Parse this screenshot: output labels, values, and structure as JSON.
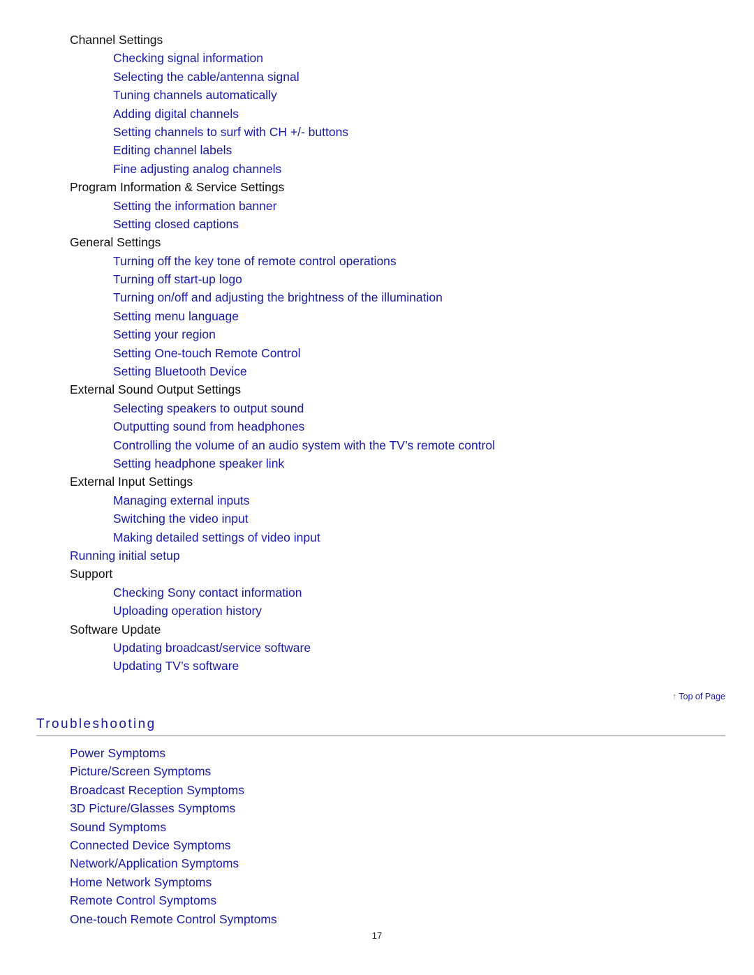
{
  "toc": [
    {
      "type": "heading",
      "level": 1,
      "text": "Channel Settings"
    },
    {
      "type": "link",
      "level": 2,
      "text": "Checking signal information"
    },
    {
      "type": "link",
      "level": 2,
      "text": "Selecting the cable/antenna signal"
    },
    {
      "type": "link",
      "level": 2,
      "text": "Tuning channels automatically"
    },
    {
      "type": "link",
      "level": 2,
      "text": "Adding digital channels"
    },
    {
      "type": "link",
      "level": 2,
      "text": "Setting channels to surf with CH +/- buttons"
    },
    {
      "type": "link",
      "level": 2,
      "text": "Editing channel labels"
    },
    {
      "type": "link",
      "level": 2,
      "text": "Fine adjusting analog channels"
    },
    {
      "type": "heading",
      "level": 1,
      "text": "Program Information & Service Settings"
    },
    {
      "type": "link",
      "level": 2,
      "text": "Setting the information banner"
    },
    {
      "type": "link",
      "level": 2,
      "text": "Setting closed captions"
    },
    {
      "type": "heading",
      "level": 1,
      "text": "General Settings"
    },
    {
      "type": "link",
      "level": 2,
      "text": "Turning off the key tone of remote control operations"
    },
    {
      "type": "link",
      "level": 2,
      "text": "Turning off start-up logo"
    },
    {
      "type": "link",
      "level": 2,
      "text": "Turning on/off and adjusting the brightness of the illumination"
    },
    {
      "type": "link",
      "level": 2,
      "text": "Setting menu language"
    },
    {
      "type": "link",
      "level": 2,
      "text": "Setting your region"
    },
    {
      "type": "link",
      "level": 2,
      "text": "Setting One-touch Remote Control"
    },
    {
      "type": "link",
      "level": 2,
      "text": "Setting Bluetooth Device"
    },
    {
      "type": "heading",
      "level": 1,
      "text": "External Sound Output Settings"
    },
    {
      "type": "link",
      "level": 2,
      "text": "Selecting speakers to output sound"
    },
    {
      "type": "link",
      "level": 2,
      "text": "Outputting sound from headphones"
    },
    {
      "type": "link",
      "level": 2,
      "text": "Controlling the volume of an audio system with the TV’s remote control"
    },
    {
      "type": "link",
      "level": 2,
      "text": "Setting headphone speaker link"
    },
    {
      "type": "heading",
      "level": 1,
      "text": "External Input Settings"
    },
    {
      "type": "link",
      "level": 2,
      "text": "Managing external inputs"
    },
    {
      "type": "link",
      "level": 2,
      "text": "Switching the video input"
    },
    {
      "type": "link",
      "level": 2,
      "text": "Making detailed settings of video input"
    },
    {
      "type": "link",
      "level": 1,
      "text": "Running initial setup"
    },
    {
      "type": "heading",
      "level": 1,
      "text": "Support"
    },
    {
      "type": "link",
      "level": 2,
      "text": "Checking Sony contact information"
    },
    {
      "type": "link",
      "level": 2,
      "text": "Uploading operation history"
    },
    {
      "type": "heading",
      "level": 1,
      "text": "Software Update"
    },
    {
      "type": "link",
      "level": 2,
      "text": "Updating broadcast/service software"
    },
    {
      "type": "link",
      "level": 2,
      "text": "Updating TV’s software"
    }
  ],
  "top_of_page": {
    "icon": "up-arrow-icon",
    "arrow_glyph": "↑",
    "label": "Top of Page"
  },
  "troubleshooting": {
    "title": "Troubleshooting",
    "links": [
      "Power Symptoms",
      "Picture/Screen Symptoms",
      "Broadcast Reception Symptoms",
      "3D Picture/Glasses Symptoms",
      "Sound Symptoms",
      "Connected Device Symptoms",
      "Network/Application Symptoms",
      "Home Network Symptoms",
      "Remote Control Symptoms",
      "One-touch Remote Control Symptoms"
    ]
  },
  "page_number": "17",
  "colors": {
    "link": "#1a1aa8",
    "heading": "#111111",
    "rule": "#c0c0c0"
  }
}
